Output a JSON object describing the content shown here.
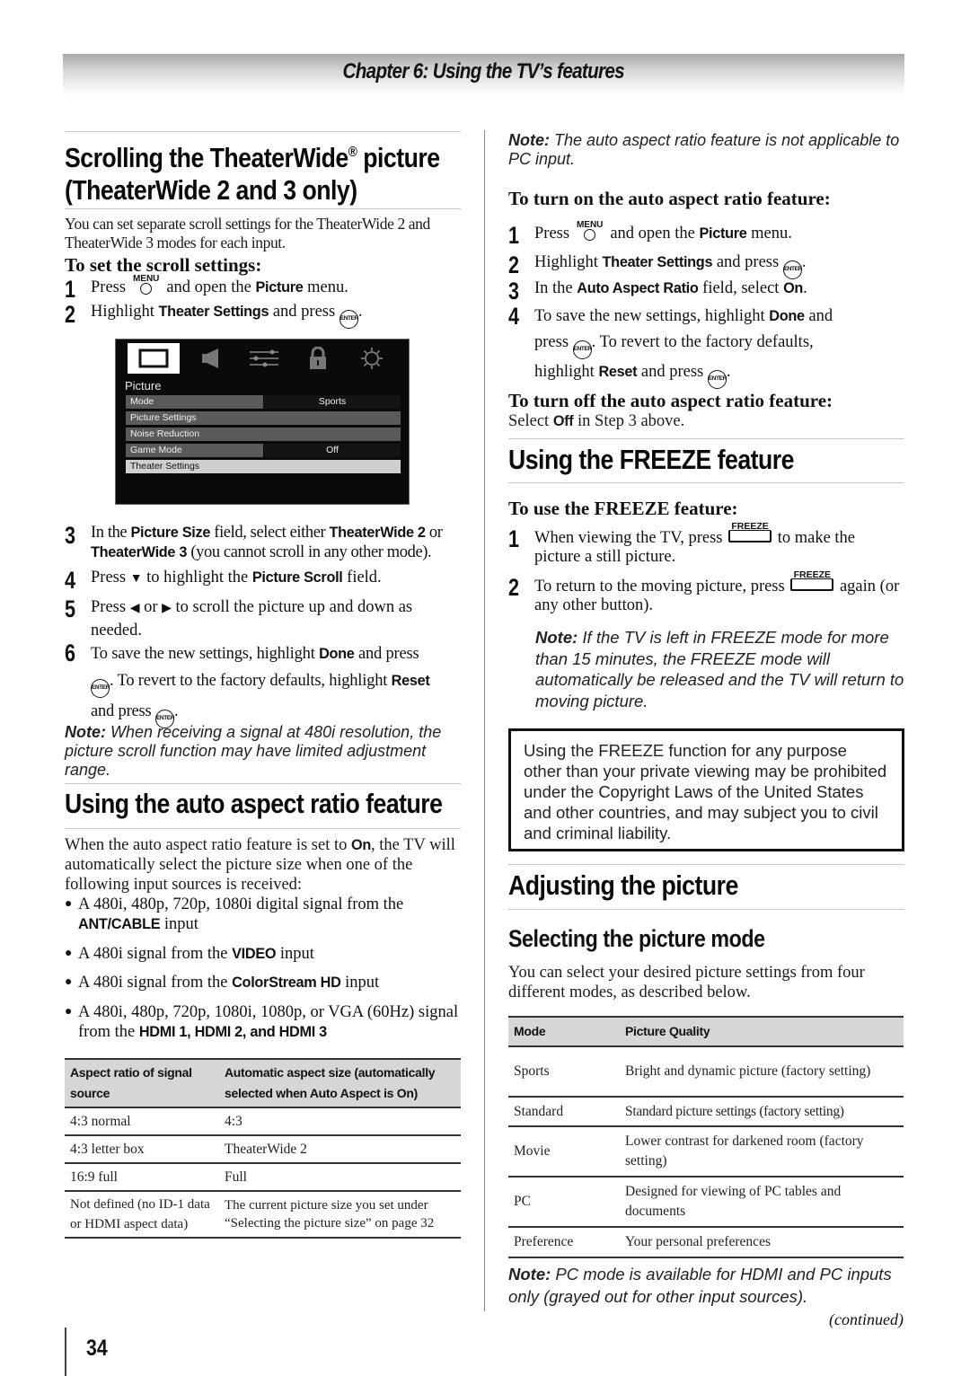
{
  "chapter_title": "Chapter 6: Using the TV’s features",
  "left": {
    "scroll_heading_line1": "Scrolling the TheaterWide",
    "scroll_heading_reg": "®",
    "scroll_heading_line1_end": " picture",
    "scroll_heading_line2": "(TheaterWide 2 and 3 only)",
    "scroll_intro": "You can set separate scroll settings for the TheaterWide 2 and TheaterWide 3 modes for each input.",
    "scroll_subheading": "To set the scroll settings:",
    "steps": [
      {
        "num": "1",
        "a": "Press ",
        "b": " and open the ",
        "bold": "Picture",
        "c": " menu."
      },
      {
        "num": "2",
        "a": "Highlight ",
        "bold": "Theater Settings",
        "b": " and press ",
        "c": "."
      },
      {
        "num": "3",
        "a": "In the ",
        "bold1": "Picture Size",
        "b": " field, select either ",
        "bold2": "TheaterWide 2",
        "c": " or ",
        "bold3": "TheaterWide 3",
        "d": " (you cannot scroll in any other mode)."
      },
      {
        "num": "4",
        "a": "Press ",
        "arrow": "▼",
        "b": " to highlight the ",
        "bold": "Picture Scroll",
        "c": " field."
      },
      {
        "num": "5",
        "a": "Press ",
        "arrow1": "◀",
        "b": " or ",
        "arrow2": "▶",
        "c": " to scroll the picture up and down as needed."
      },
      {
        "num": "6",
        "a": "To save the new settings, highlight ",
        "bold1": "Done",
        "b": " and press",
        "c": ". To revert to the factory defaults, highlight ",
        "bold2": "Reset",
        "d": "and press ",
        "e": "."
      }
    ],
    "note_label": "Note:",
    "note_480i": " When receiving a signal at 480i resolution, the picture scroll function may have limited adjustment range.",
    "auto_heading": "Using the auto aspect ratio feature",
    "auto_intro_a": "When the auto aspect ratio feature is set to ",
    "auto_intro_bold": "On",
    "auto_intro_b": ", the TV will automatically select the picture size when one of the following input sources is received:",
    "bullets": [
      {
        "a": "A 480i, 480p, 720p, 1080i digital signal from the ",
        "bold": "ANT/CABLE",
        "b": " input"
      },
      {
        "a": "A 480i signal from the  ",
        "bold": "VIDEO",
        "b": " input"
      },
      {
        "a": "A 480i signal from the ",
        "bold": "ColorStream HD",
        "b": " input"
      },
      {
        "a": "A 480i, 480p, 720p, 1080i, 1080p, or VGA (60Hz) signal from the ",
        "bold": "HDMI 1, HDMI 2, and HDMI 3",
        "b": ""
      }
    ],
    "aspect_table": {
      "headers": [
        "Aspect ratio of signal source",
        "Automatic aspect size (automatically selected when Auto Aspect is On)"
      ],
      "rows": [
        [
          "4:3 normal",
          "4:3"
        ],
        [
          "4:3 letter box",
          "TheaterWide 2"
        ],
        [
          "16:9 full",
          "Full"
        ],
        [
          "Not defined (no ID-1 data or HDMI aspect data)",
          "The current picture size you set under “Selecting the picture size” on page 32"
        ]
      ]
    }
  },
  "tv_menu": {
    "tabs": [
      "picture-tab",
      "audio-tab",
      "setup-tab",
      "lock-tab",
      "options-tab"
    ],
    "active_tab": "picture-tab",
    "title": "Picture",
    "rows": [
      {
        "label": "Mode",
        "value": "Sports"
      },
      {
        "label": "Picture Settings",
        "value": ""
      },
      {
        "label": "Noise Reduction",
        "value": ""
      },
      {
        "label": "Game Mode",
        "value": "Off"
      },
      {
        "label": "Theater Settings",
        "value": "",
        "selected": true
      }
    ]
  },
  "right": {
    "note_label": "Note:",
    "note_pc": " The auto aspect ratio feature is not applicable to PC input.",
    "on_heading": "To turn on the auto aspect ratio feature:",
    "on_steps": [
      {
        "num": "1",
        "a": "Press ",
        "b": " and open the ",
        "bold": "Picture",
        "c": " menu."
      },
      {
        "num": "2",
        "a": "Highlight ",
        "bold": "Theater Settings",
        "b": " and press ",
        "c": "."
      },
      {
        "num": "3",
        "a": "In the ",
        "bold1": "Auto Aspect Ratio",
        "b": " field, select ",
        "bold2": "On",
        "c": "."
      },
      {
        "num": "4",
        "a": "To save the new settings, highlight ",
        "bold1": "Done",
        "b": " and",
        "c": "press ",
        "d": ". To revert to the factory defaults,",
        "e": "highlight ",
        "bold2": "Reset",
        "f": " and press ",
        "g": "."
      }
    ],
    "off_heading": "To turn off the auto aspect ratio feature:",
    "off_text_a": "Select ",
    "off_text_bold": "Off",
    "off_text_b": " in Step 3 above.",
    "freeze_heading": "Using the FREEZE feature",
    "freeze_subheading": "To use the FREEZE feature:",
    "freeze_steps": [
      {
        "num": "1",
        "a": "When viewing the TV, press ",
        "b": " to make the picture a still picture."
      },
      {
        "num": "2",
        "a": "To return to the moving picture, press ",
        "b": " again (or any other button)."
      }
    ],
    "freeze_note": " If the TV is left in FREEZE mode for more than 15 minutes, the FREEZE mode will automatically be released and the TV will return to moving picture.",
    "warning": "Using the FREEZE function for any purpose other than your private viewing may be prohibited under the Copyright Laws of the United States and other countries, and may subject you to civil and criminal liability.",
    "adjust_heading": "Adjusting the picture",
    "mode_subheading": "Selecting the picture mode",
    "mode_intro": "You can select your desired picture settings from four different modes, as described below.",
    "mode_table": {
      "headers": [
        "Mode",
        "Picture Quality"
      ],
      "rows": [
        [
          "Sports",
          "Bright and dynamic picture (factory setting)"
        ],
        [
          "Standard",
          "Standard picture settings (factory setting)"
        ],
        [
          "Movie",
          "Lower contrast for darkened room (factory setting)"
        ],
        [
          "PC",
          "Designed for viewing of PC tables and documents"
        ],
        [
          "Preference",
          "Your personal preferences"
        ]
      ]
    },
    "pc_note": " PC mode is available for HDMI and PC inputs only (grayed out for other input sources).",
    "continued": "(continued)"
  },
  "icons": {
    "menu_label": "MENU",
    "enter_label": "ENTER",
    "freeze_label": "FREEZE"
  },
  "page_number": "34"
}
